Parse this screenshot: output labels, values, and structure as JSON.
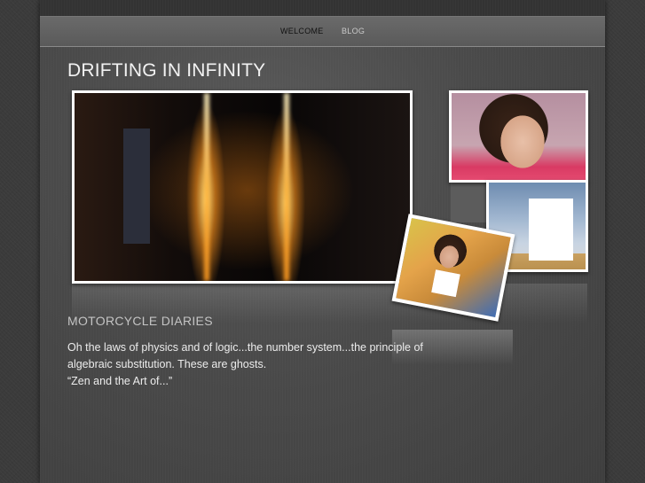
{
  "nav": {
    "items": [
      {
        "label": "WELCOME",
        "active": true
      },
      {
        "label": "BLOG",
        "active": false
      }
    ]
  },
  "site": {
    "title": "DRIFTING IN INFINITY"
  },
  "post": {
    "title": "MOTORCYCLE DIARIES",
    "line1": "Oh the laws of physics and of logic...the number system...the principle of",
    "line2": "algebraic substitution. These are ghosts.",
    "line3": "“Zen and the Art of...”"
  },
  "colors": {
    "background": "#3b3b3b",
    "navbar": "#616161",
    "title_text": "#f2f2f2"
  },
  "images": [
    {
      "name": "fireworks-photo"
    },
    {
      "name": "girl-portrait-photo"
    },
    {
      "name": "white-house-photo"
    },
    {
      "name": "girl-sitting-photo"
    }
  ]
}
